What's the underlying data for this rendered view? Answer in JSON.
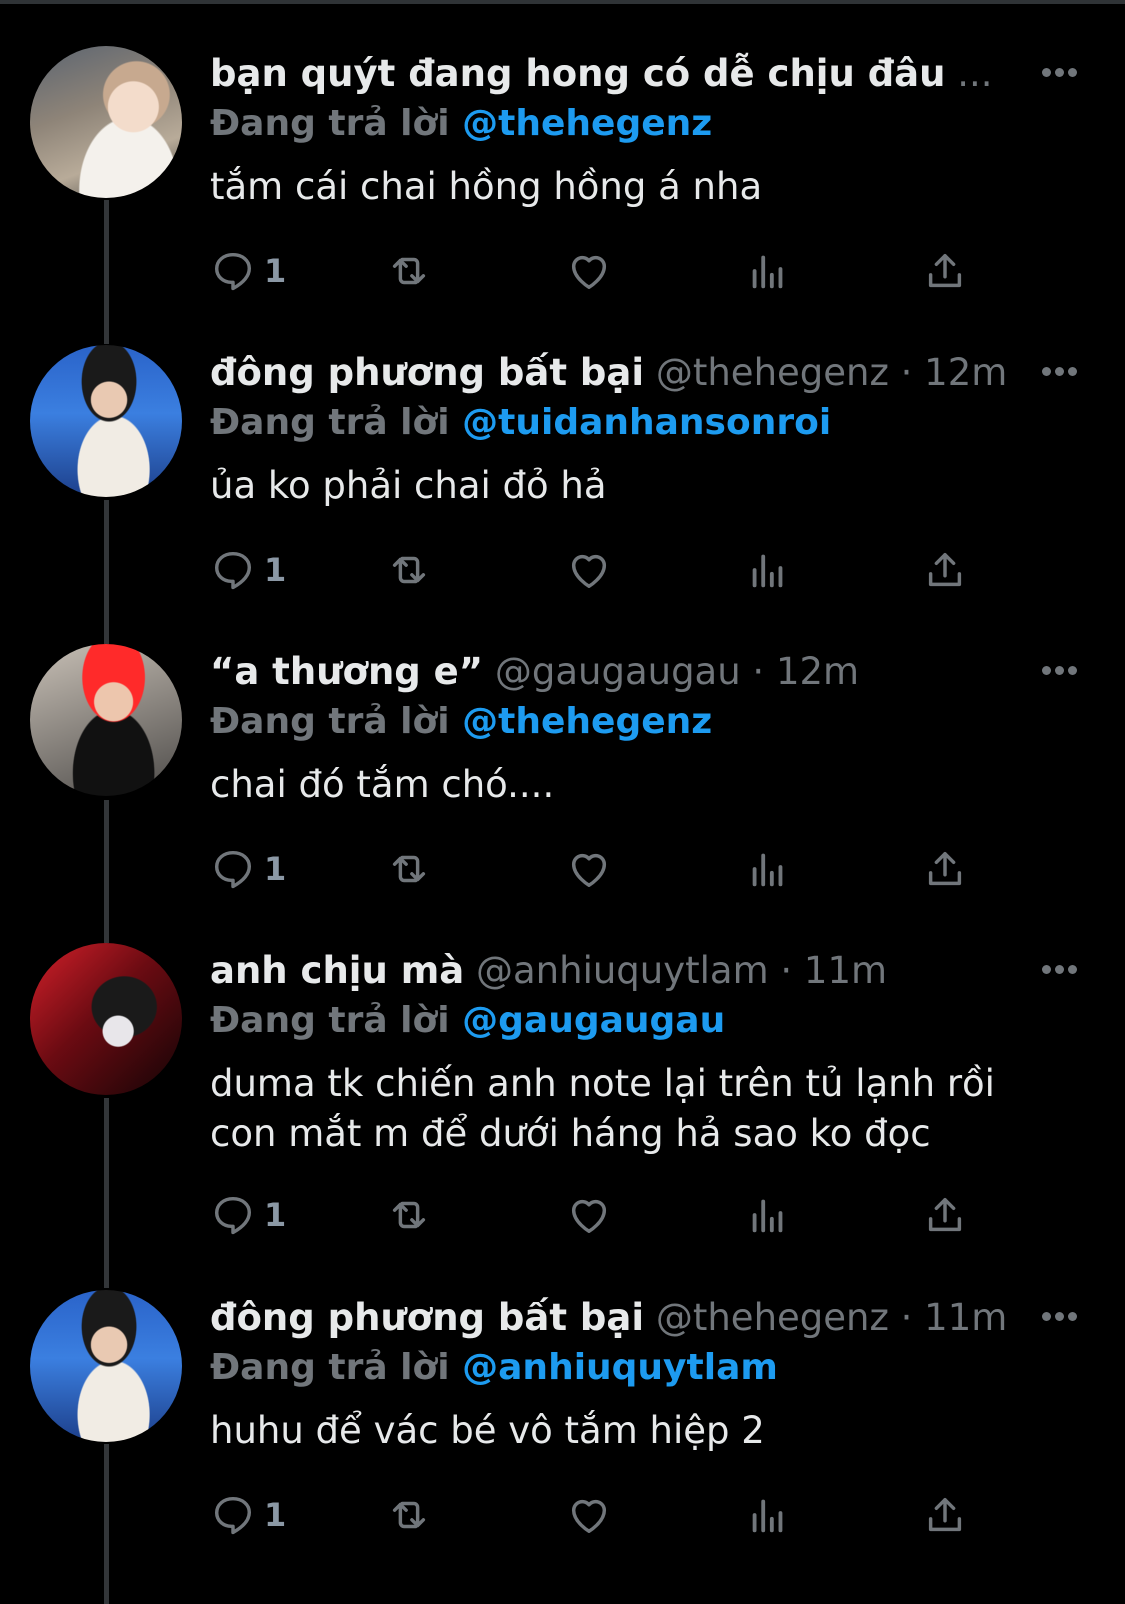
{
  "replying_prefix": "Đang trả lời",
  "tweets": [
    {
      "display_name": "bạn quýt đang hong có dễ chịu đâu",
      "handle_time": "...",
      "reply_to": "@thehegenz",
      "text": "tắm cái chai hồng hồng á nha",
      "reply_count": "1"
    },
    {
      "display_name": "đông phương bất bại",
      "handle_time": "@thehegenz · 12m",
      "reply_to": "@tuidanhansonroi",
      "text": "ủa ko phải chai đỏ hả",
      "reply_count": "1"
    },
    {
      "display_name": "“a thương e”",
      "handle_time": "@gaugaugau · 12m",
      "reply_to": "@thehegenz",
      "text": "chai đó tắm chó....",
      "reply_count": "1"
    },
    {
      "display_name": "anh chịu mà",
      "handle_time": "@anhiuquytlam · 11m",
      "reply_to": "@gaugaugau",
      "text_line1": "duma tk chiến anh note lại trên tủ lạnh rồi",
      "text_line2": "con mắt m để dưới háng hả sao ko đọc",
      "reply_count": "1"
    },
    {
      "display_name": "đông phương bất bại",
      "handle_time": "@thehegenz · 11m",
      "reply_to": "@anhiuquytlam",
      "text": "huhu để vác bé vô tắm hiệp 2",
      "reply_count": "1"
    }
  ],
  "colors": {
    "background": "#000000",
    "text": "#e7e9ea",
    "muted": "#71767b",
    "link": "#1d9bf0"
  }
}
